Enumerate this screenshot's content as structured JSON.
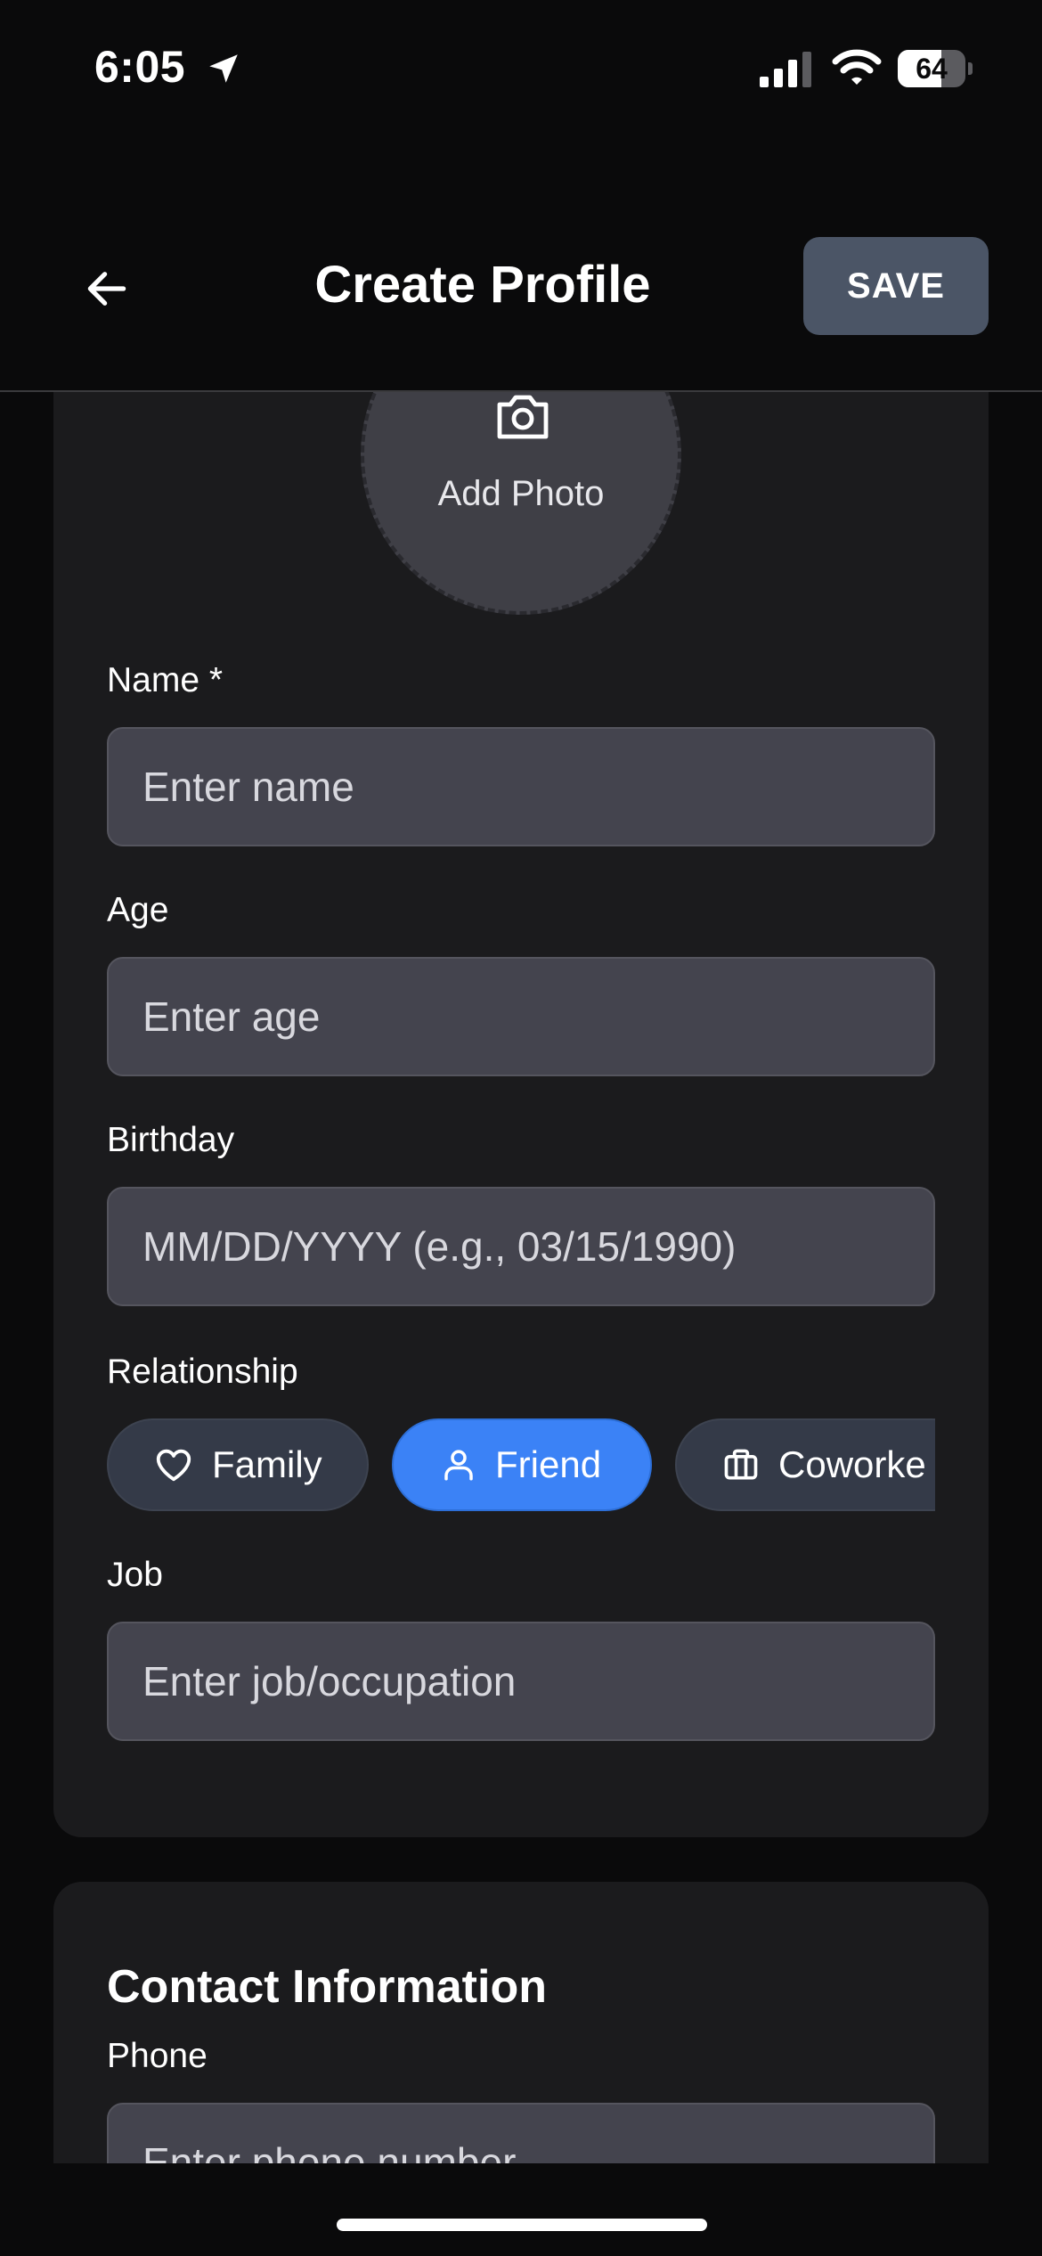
{
  "status_bar": {
    "time": "6:05",
    "battery_level": 64,
    "battery_label": "64",
    "icons": [
      "location-arrow-icon",
      "cellular-signal-icon",
      "wifi-icon",
      "battery-icon"
    ]
  },
  "header": {
    "title": "Create Profile",
    "save_label": "SAVE",
    "back_icon": "arrow-left-icon"
  },
  "photo": {
    "label": "Add Photo",
    "icon": "camera-icon"
  },
  "fields": {
    "name": {
      "label": "Name *",
      "placeholder": "Enter name",
      "value": ""
    },
    "age": {
      "label": "Age",
      "placeholder": "Enter age",
      "value": ""
    },
    "birthday": {
      "label": "Birthday",
      "placeholder": "MM/DD/YYYY (e.g., 03/15/1990)",
      "value": ""
    },
    "job": {
      "label": "Job",
      "placeholder": "Enter job/occupation",
      "value": ""
    }
  },
  "relationship": {
    "label": "Relationship",
    "options": [
      {
        "label": "Family",
        "icon": "heart-icon",
        "selected": false
      },
      {
        "label": "Friend",
        "icon": "user-icon",
        "selected": true
      },
      {
        "label": "Coworke",
        "icon": "briefcase-icon",
        "selected": false
      }
    ]
  },
  "contact": {
    "title": "Contact Information",
    "phone": {
      "label": "Phone",
      "placeholder": "Enter phone number",
      "value": ""
    }
  },
  "colors": {
    "background": "#0a0a0b",
    "card": "#1b1b1d",
    "input": "#44444e",
    "save_button": "#4b5566",
    "chip": "#343a48",
    "chip_selected": "#3b82f6"
  }
}
